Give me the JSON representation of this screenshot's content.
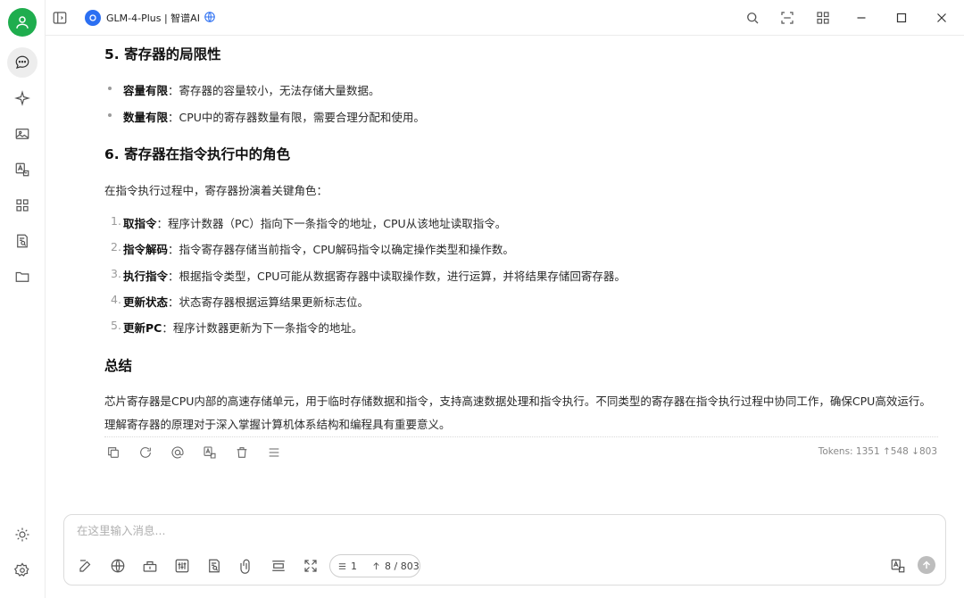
{
  "app": {
    "title": "GLM-4-Plus | 智谱AI"
  },
  "sidebar": {
    "items": [
      {
        "name": "chat",
        "icon": "chat-bubble-icon",
        "active": true
      },
      {
        "name": "assistants",
        "icon": "sparkle-icon"
      },
      {
        "name": "images",
        "icon": "image-icon"
      },
      {
        "name": "translate",
        "icon": "translate-icon"
      },
      {
        "name": "apps",
        "icon": "grid-icon"
      },
      {
        "name": "knowledge",
        "icon": "document-search-icon"
      },
      {
        "name": "files",
        "icon": "folder-icon"
      }
    ],
    "bottom": [
      {
        "name": "theme",
        "icon": "sun-icon"
      },
      {
        "name": "settings",
        "icon": "gear-icon"
      }
    ]
  },
  "message": {
    "section5": {
      "title": "5. 寄存器的局限性",
      "items": [
        {
          "bold": "容量有限",
          "text": "：寄存器的容量较小，无法存储大量数据。"
        },
        {
          "bold": "数量有限",
          "text": "：CPU中的寄存器数量有限，需要合理分配和使用。"
        }
      ]
    },
    "section6": {
      "title": "6. 寄存器在指令执行中的角色",
      "intro": "在指令执行过程中，寄存器扮演着关键角色：",
      "steps": [
        {
          "num": "1.",
          "bold": "取指令",
          "text": "：程序计数器（PC）指向下一条指令的地址，CPU从该地址读取指令。"
        },
        {
          "num": "2.",
          "bold": "指令解码",
          "text": "：指令寄存器存储当前指令，CPU解码指令以确定操作类型和操作数。"
        },
        {
          "num": "3.",
          "bold": "执行指令",
          "text": "：根据指令类型，CPU可能从数据寄存器中读取操作数，进行运算，并将结果存储回寄存器。"
        },
        {
          "num": "4.",
          "bold": "更新状态",
          "text": "：状态寄存器根据运算结果更新标志位。"
        },
        {
          "num": "5.",
          "bold": "更新PC",
          "text": "：程序计数器更新为下一条指令的地址。"
        }
      ]
    },
    "summary": {
      "title": "总结",
      "text": "芯片寄存器是CPU内部的高速存储单元，用于临时存储数据和指令，支持高速数据处理和指令执行。不同类型的寄存器在指令执行过程中协同工作，确保CPU高效运行。理解寄存器的原理对于深入掌握计算机体系结构和编程具有重要意义。"
    },
    "tokens": "Tokens: 1351 ↑548 ↓803"
  },
  "input": {
    "placeholder": "在这里输入消息...",
    "value": "",
    "context_count": "1",
    "token_count": "8 / 803"
  },
  "colors": {
    "avatar": "#1fad4e",
    "model_icon": "#2b6ff2",
    "send_disabled": "#bdbdbd"
  }
}
